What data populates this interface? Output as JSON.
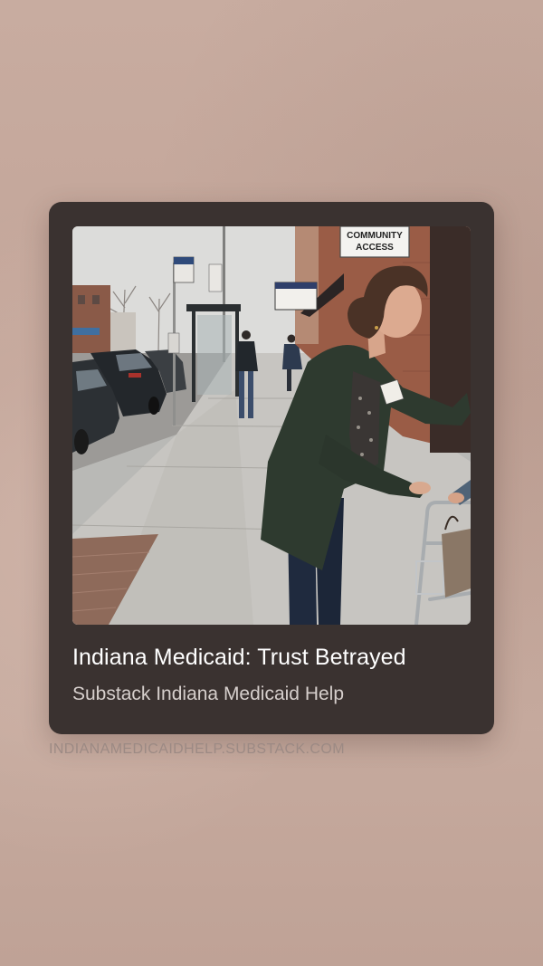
{
  "card": {
    "image_alt": "Woman helping a person with a walker on a sidewalk outside a Community Access office",
    "photo_signs": {
      "community_access": [
        "COMMUNITY",
        "ACCESS"
      ]
    },
    "title": "Indiana Medicaid: Trust Betrayed",
    "subtitle": "Substack Indiana Medicaid Help"
  },
  "footer": {
    "domain": "INDIANAMEDICAIDHELP.SUBSTACK.COM"
  },
  "colors": {
    "background": "#c4a89c",
    "card": "#3a3230",
    "title": "#ffffff",
    "subtitle": "#d6cfcc",
    "domain": "#9c8a84"
  }
}
